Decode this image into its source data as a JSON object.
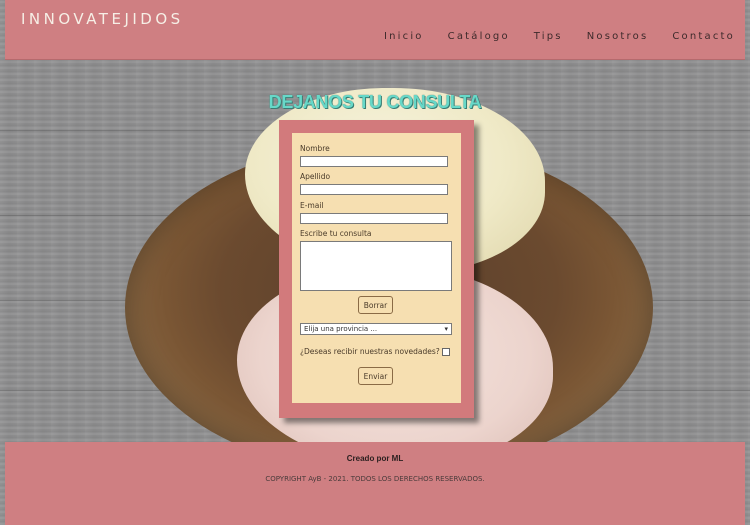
{
  "header": {
    "brand": "INNOVATEJIDOS",
    "nav": [
      "Inicio",
      "Catálogo",
      "Tips",
      "Nosotros",
      "Contacto"
    ]
  },
  "title": "DEJANOS TU CONSULTA",
  "form": {
    "name_label": "Nombre",
    "name_value": "",
    "surname_label": "Apellido",
    "surname_value": "",
    "email_label": "E-mail",
    "email_value": "",
    "message_label": "Escribe tu consulta",
    "message_value": "",
    "reset_label": "Borrar",
    "province_selected": "Elija una provincia ...",
    "newsletter_label": "¿Deseas recibir nuestras novedades?",
    "newsletter_checked": false,
    "submit_label": "Enviar"
  },
  "footer": {
    "credit": "Creado por ML",
    "copyright": "COPYRIGHT AyB - 2021. TODOS LOS DERECHOS RESERVADOS."
  },
  "colors": {
    "header_bg": "#cf7f82",
    "card_border": "#d27a7c",
    "card_bg": "#f6dfb1",
    "title": "#67d8c8"
  }
}
